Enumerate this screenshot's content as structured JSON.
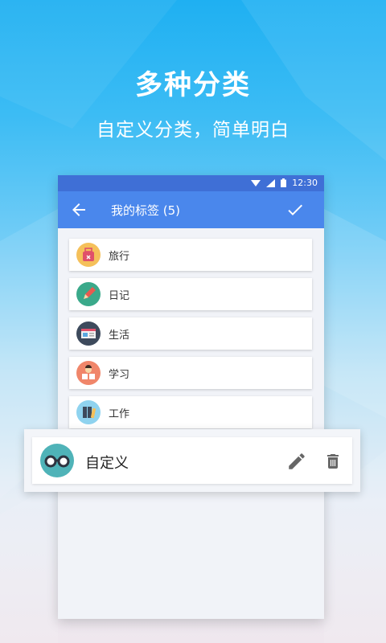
{
  "promo": {
    "headline": "多种分类",
    "subline": "自定义分类，简单明白"
  },
  "status_bar": {
    "time": "12:30",
    "icons": [
      "wifi-icon",
      "signal-icon",
      "battery-icon"
    ]
  },
  "app_bar": {
    "title": "我的标签 (5)",
    "back_icon": "arrow-left-icon",
    "confirm_icon": "check-icon"
  },
  "tags": [
    {
      "label": "旅行",
      "icon": "suitcase-icon",
      "color": "#f5c05a"
    },
    {
      "label": "日记",
      "icon": "pencil-icon",
      "color": "#3aa98a"
    },
    {
      "label": "生活",
      "icon": "monitor-icon",
      "color": "#3d4a5c"
    },
    {
      "label": "学习",
      "icon": "reader-icon",
      "color": "#f0866a"
    },
    {
      "label": "工作",
      "icon": "binders-icon",
      "color": "#8fd3ef"
    }
  ],
  "dragged_tag": {
    "label": "自定义",
    "icon": "glasses-icon",
    "color": "#4fb3b8",
    "actions": [
      "edit-icon",
      "delete-icon"
    ]
  },
  "colors": {
    "status_bar": "#3f6fd6",
    "app_bar": "#4a87ec",
    "list_bg": "#f1f3f8"
  }
}
